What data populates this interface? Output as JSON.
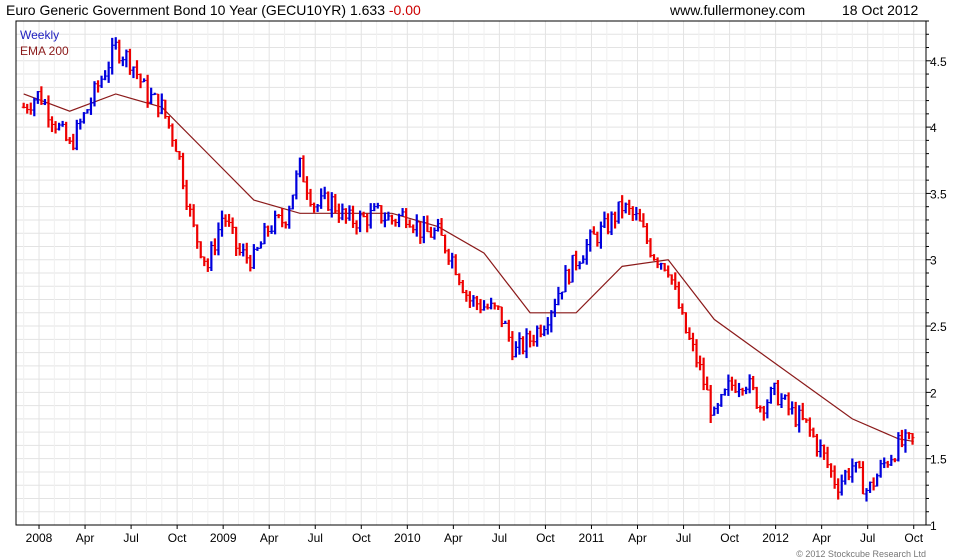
{
  "header": {
    "title": "Euro Generic Government Bond 10 Year (GECU10YR) 1.633",
    "change": "-0.00",
    "site": "www.fullermoney.com",
    "date": "18 Oct 2012"
  },
  "copyright": "© 2012 Stockcube Research Ltd",
  "colors": {
    "up": "#0000dd",
    "down": "#ee0000",
    "ema": "#8b1a1a",
    "grid": "#e3e3e3"
  },
  "chart_data": {
    "type": "candlestick",
    "grid": true,
    "legend": [
      "Weekly",
      "EMA 200"
    ],
    "yticks": [
      "4.5",
      "4",
      "3.5",
      "3",
      "2.5",
      "2",
      "1.5",
      "1"
    ],
    "xticks": [
      "2008",
      "Apr",
      "Jul",
      "Oct",
      "2009",
      "Apr",
      "Jul",
      "Oct",
      "2010",
      "Apr",
      "Jul",
      "Oct",
      "2011",
      "Apr",
      "Jul",
      "Oct",
      "2012",
      "Apr",
      "Jul",
      "Oct"
    ],
    "ylim": [
      1.0,
      4.8
    ],
    "series": [
      {
        "name": "Weekly",
        "x": [
          "2007-12",
          "2008-01",
          "2008-02",
          "2008-03",
          "2008-04",
          "2008-05",
          "2008-06",
          "2008-07",
          "2008-08",
          "2008-09",
          "2008-10",
          "2008-11",
          "2008-12",
          "2009-01",
          "2009-02",
          "2009-03",
          "2009-04",
          "2009-05",
          "2009-06",
          "2009-07",
          "2009-08",
          "2009-09",
          "2009-10",
          "2009-11",
          "2009-12",
          "2010-01",
          "2010-02",
          "2010-03",
          "2010-04",
          "2010-05",
          "2010-06",
          "2010-07",
          "2010-08",
          "2010-09",
          "2010-10",
          "2010-11",
          "2010-12",
          "2011-01",
          "2011-02",
          "2011-03",
          "2011-04",
          "2011-05",
          "2011-06",
          "2011-07",
          "2011-08",
          "2011-09",
          "2011-10",
          "2011-11",
          "2011-12",
          "2012-01",
          "2012-02",
          "2012-03",
          "2012-04",
          "2012-05",
          "2012-06",
          "2012-07",
          "2012-08",
          "2012-09",
          "2012-10"
        ],
        "values": [
          4.15,
          4.25,
          4.05,
          3.85,
          4.1,
          4.35,
          4.6,
          4.5,
          4.25,
          4.15,
          3.85,
          3.25,
          2.95,
          3.35,
          3.05,
          3.0,
          3.25,
          3.3,
          3.7,
          3.4,
          3.45,
          3.3,
          3.3,
          3.35,
          3.3,
          3.35,
          3.2,
          3.2,
          3.0,
          2.7,
          2.65,
          2.6,
          2.3,
          2.4,
          2.55,
          2.8,
          3.0,
          3.15,
          3.25,
          3.4,
          3.3,
          3.05,
          2.95,
          2.5,
          2.2,
          1.8,
          2.05,
          2.1,
          1.9,
          2.0,
          1.85,
          1.75,
          1.55,
          1.3,
          1.45,
          1.25,
          1.45,
          1.6,
          1.633
        ]
      },
      {
        "name": "EMA 200",
        "x": [
          "2007-12",
          "2008-03",
          "2008-06",
          "2008-09",
          "2008-12",
          "2009-03",
          "2009-06",
          "2009-09",
          "2009-12",
          "2010-03",
          "2010-06",
          "2010-09",
          "2010-12",
          "2011-03",
          "2011-06",
          "2011-09",
          "2011-12",
          "2012-03",
          "2012-06",
          "2012-09",
          "2012-10"
        ],
        "values": [
          4.25,
          4.12,
          4.25,
          4.15,
          3.8,
          3.45,
          3.35,
          3.35,
          3.35,
          3.25,
          3.05,
          2.6,
          2.6,
          2.95,
          3.0,
          2.55,
          2.3,
          2.05,
          1.8,
          1.65,
          1.63
        ]
      }
    ]
  }
}
